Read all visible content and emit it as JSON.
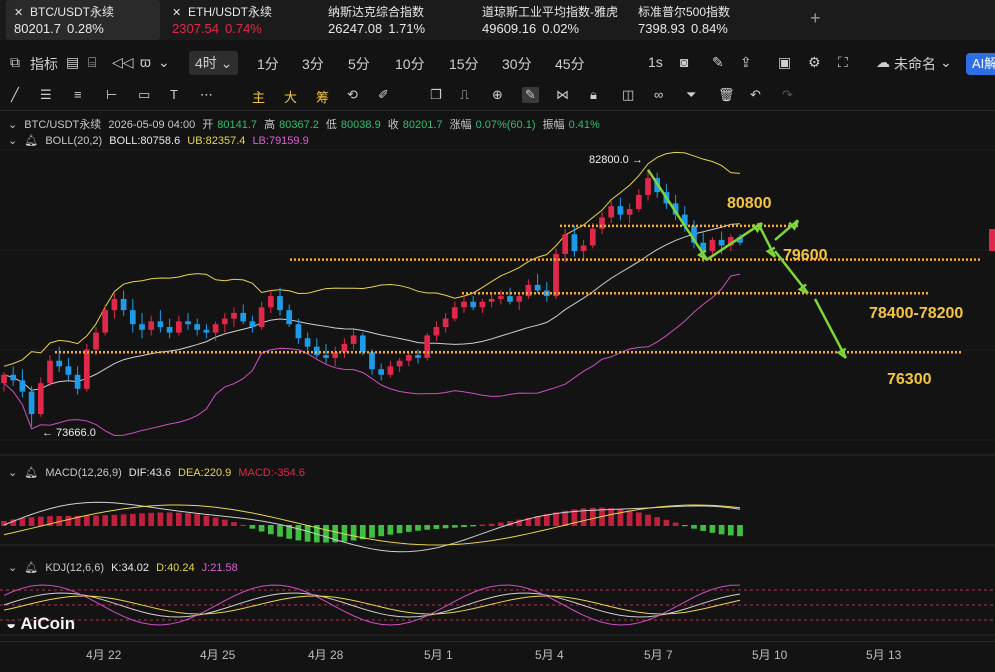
{
  "tickers": [
    {
      "name": "BTC/USDT永续",
      "price": "80201.7",
      "change": "0.28%",
      "price_color": "#e8e8e8",
      "change_color": "#e8e8e8"
    },
    {
      "name": "ETH/USDT永续",
      "price": "2307.54",
      "change": "0.74%",
      "price_color": "#e0294a",
      "change_color": "#e0294a"
    },
    {
      "name": "纳斯达克综合指数",
      "price": "26247.08",
      "change": "1.71%",
      "price_color": "#e8e8e8",
      "change_color": "#e8e8e8"
    },
    {
      "name": "道琼斯工业平均指数-雅虎",
      "price": "49609.16",
      "change": "0.02%",
      "price_color": "#e8e8e8",
      "change_color": "#e8e8e8"
    },
    {
      "name": "标准普尔500指数",
      "price": "7398.93",
      "change": "0.84%",
      "price_color": "#e8e8e8",
      "change_color": "#e8e8e8"
    }
  ],
  "add_tab": "+",
  "toolbar": {
    "indicators": "指标",
    "active_interval": "4时",
    "intervals": [
      "1分",
      "3分",
      "5分",
      "10分",
      "15分",
      "30分",
      "45分"
    ],
    "seconds": "1s",
    "layout_name": "未命名",
    "ai_label": "AI解"
  },
  "drawing_tools": {
    "zhu": "主",
    "da": "大",
    "chou": "筹"
  },
  "info": {
    "symbol": "BTC/USDT永续",
    "datetime": "2026-05-09 04:00",
    "open_label": "开",
    "open": "80141.7",
    "high_label": "高",
    "high": "80367.2",
    "low_label": "低",
    "low": "80038.9",
    "close_label": "收",
    "close": "80201.7",
    "chg_label": "涨幅",
    "chg": "0.07%(60.1)",
    "amp_label": "振幅",
    "amp": "0.41%"
  },
  "boll": {
    "name": "BOLL(20,2)",
    "mid": "BOLL:80758.6",
    "ub": "UB:82357.4",
    "lb": "LB:79159.9"
  },
  "macd": {
    "name": "MACD(12,26,9)",
    "dif": "DIF:43.6",
    "dea": "DEA:220.9",
    "macd": "MACD:-354.6"
  },
  "kdj": {
    "name": "KDJ(12,6,6)",
    "k": "K:34.02",
    "d": "D:40.24",
    "j": "J:21.58"
  },
  "annotations": {
    "high_marker": "82800.0 →",
    "low_marker": "← 73666.0",
    "levels": [
      "80800",
      "79600",
      "78400-78200",
      "76300"
    ]
  },
  "x_labels": [
    "4月 22",
    "4月 25",
    "4月 28",
    "5月 1",
    "5月 4",
    "5月 7",
    "5月 10",
    "5月 13"
  ],
  "logo": "AiCoin",
  "colors": {
    "up": "#e0294a",
    "down": "#1e9be8",
    "boll_upper": "#e8d44d",
    "boll_lower": "#d04fc0",
    "boll_mid": "#cfcfcf",
    "level_line": "#f4a83d",
    "arrow": "#7dd63a",
    "macd_up": "#c0203c",
    "macd_down": "#3fbf3f"
  },
  "chart_data": {
    "type": "candlestick",
    "interval": "4h",
    "y_range": [
      73000,
      83500
    ],
    "candles": [
      [
        75200,
        75600,
        74900,
        75500
      ],
      [
        75500,
        75800,
        75100,
        75300
      ],
      [
        75300,
        75700,
        74700,
        74900
      ],
      [
        74900,
        75100,
        73666,
        74100
      ],
      [
        74100,
        75400,
        74000,
        75200
      ],
      [
        75200,
        76200,
        75100,
        76000
      ],
      [
        76000,
        76500,
        75600,
        75800
      ],
      [
        75800,
        76100,
        75300,
        75500
      ],
      [
        75500,
        75800,
        74800,
        75000
      ],
      [
        75000,
        76600,
        74900,
        76400
      ],
      [
        76400,
        77200,
        76200,
        77000
      ],
      [
        77000,
        78000,
        76900,
        77800
      ],
      [
        77800,
        78400,
        77500,
        78200
      ],
      [
        78200,
        78500,
        77600,
        77800
      ],
      [
        77800,
        78200,
        77000,
        77300
      ],
      [
        77300,
        77700,
        76800,
        77100
      ],
      [
        77100,
        77600,
        76900,
        77400
      ],
      [
        77400,
        77800,
        77000,
        77200
      ],
      [
        77200,
        77500,
        76800,
        77000
      ],
      [
        77000,
        77600,
        76900,
        77400
      ],
      [
        77400,
        77700,
        77100,
        77300
      ],
      [
        77300,
        77500,
        76900,
        77100
      ],
      [
        77100,
        77300,
        76800,
        77000
      ],
      [
        77000,
        77400,
        76700,
        77300
      ],
      [
        77300,
        77700,
        77000,
        77500
      ],
      [
        77500,
        77900,
        77200,
        77700
      ],
      [
        77700,
        78000,
        77300,
        77400
      ],
      [
        77400,
        77600,
        77000,
        77200
      ],
      [
        77200,
        78100,
        77100,
        77900
      ],
      [
        77900,
        78500,
        77700,
        78300
      ],
      [
        78300,
        78600,
        77600,
        77800
      ],
      [
        77800,
        78000,
        77200,
        77300
      ],
      [
        77300,
        77500,
        76600,
        76800
      ],
      [
        76800,
        77000,
        76300,
        76500
      ],
      [
        76500,
        76800,
        76100,
        76200
      ],
      [
        76200,
        76600,
        75900,
        76100
      ],
      [
        76100,
        76500,
        75800,
        76300
      ],
      [
        76300,
        76800,
        76100,
        76600
      ],
      [
        76600,
        77100,
        76400,
        76900
      ],
      [
        76900,
        77000,
        76200,
        76300
      ],
      [
        76300,
        76400,
        75500,
        75700
      ],
      [
        75700,
        75900,
        75300,
        75500
      ],
      [
        75500,
        76000,
        75400,
        75800
      ],
      [
        75800,
        76100,
        75600,
        76000
      ],
      [
        76000,
        76300,
        75800,
        76200
      ],
      [
        76200,
        76400,
        75900,
        76100
      ],
      [
        76100,
        77000,
        76000,
        76900
      ],
      [
        76900,
        77400,
        76700,
        77200
      ],
      [
        77200,
        77700,
        77000,
        77500
      ],
      [
        77500,
        78100,
        77400,
        77900
      ],
      [
        77900,
        78300,
        77700,
        78100
      ],
      [
        78100,
        78300,
        77800,
        77900
      ],
      [
        77900,
        78200,
        77700,
        78100
      ],
      [
        78100,
        78400,
        77900,
        78200
      ],
      [
        78200,
        78500,
        78000,
        78300
      ],
      [
        78300,
        78600,
        78000,
        78100
      ],
      [
        78100,
        78400,
        77800,
        78300
      ],
      [
        78300,
        78900,
        78200,
        78700
      ],
      [
        78700,
        79100,
        78400,
        78500
      ],
      [
        78500,
        78800,
        78100,
        78300
      ],
      [
        78300,
        80000,
        78200,
        79800
      ],
      [
        79800,
        80700,
        79500,
        80500
      ],
      [
        80500,
        80800,
        79700,
        79900
      ],
      [
        79900,
        80300,
        79600,
        80100
      ],
      [
        80100,
        80900,
        80000,
        80700
      ],
      [
        80700,
        81300,
        80500,
        81100
      ],
      [
        81100,
        81700,
        80900,
        81500
      ],
      [
        81500,
        81800,
        81000,
        81200
      ],
      [
        81200,
        81600,
        80900,
        81400
      ],
      [
        81400,
        82100,
        81300,
        81900
      ],
      [
        81900,
        82800,
        81700,
        82500
      ],
      [
        82500,
        82700,
        81800,
        82000
      ],
      [
        82000,
        82300,
        81400,
        81600
      ],
      [
        81600,
        81900,
        81000,
        81200
      ],
      [
        81200,
        81500,
        80600,
        80800
      ],
      [
        80800,
        81000,
        80000,
        80200
      ],
      [
        80200,
        80600,
        79500,
        79900
      ],
      [
        79900,
        80400,
        79700,
        80300
      ],
      [
        80300,
        80600,
        79800,
        80100
      ],
      [
        80100,
        80500,
        79900,
        80400
      ],
      [
        80400,
        80500,
        80100,
        80200
      ]
    ],
    "indicators": {
      "boll": {
        "mid": 80758.6,
        "upper": 82357.4,
        "lower": 79159.9
      },
      "macd": {
        "dif": 43.6,
        "dea": 220.9,
        "macd": -354.6
      },
      "kdj": {
        "k": 34.02,
        "d": 40.24,
        "j": 21.58
      }
    },
    "high_marker": 82800.0,
    "low_marker": 73666.0,
    "horizontal_levels": [
      80800,
      79600,
      78400,
      76300
    ],
    "last_price": 80201.7
  }
}
